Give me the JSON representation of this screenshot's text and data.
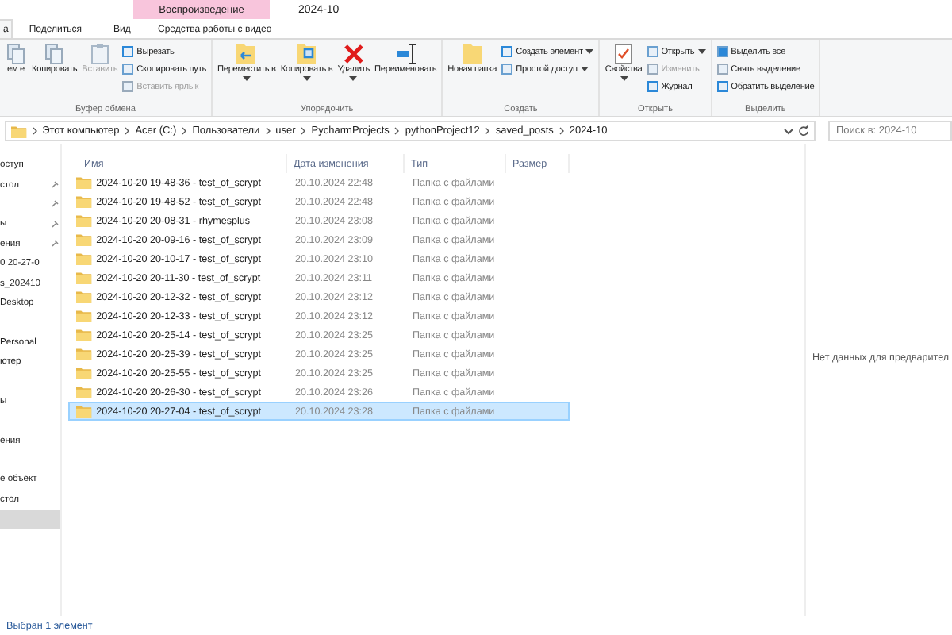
{
  "window": {
    "title": "2024-10",
    "contextual_tab": "Воспроизведение"
  },
  "tabs": [
    {
      "label": "а",
      "selected": true
    },
    {
      "label": "Поделиться",
      "selected": false
    },
    {
      "label": "Вид",
      "selected": false
    },
    {
      "label": "Средства работы с видео",
      "selected": false
    }
  ],
  "ribbon": [
    {
      "name": "Буфер обмена",
      "items": [
        {
          "kind": "large",
          "label": "ем е",
          "disabled": false,
          "dropdown": false
        },
        {
          "kind": "large",
          "label": "Копировать",
          "disabled": false,
          "dropdown": false
        },
        {
          "kind": "large",
          "label": "Вставить",
          "disabled": true,
          "dropdown": false
        },
        {
          "kind": "small",
          "label": "Вырезать",
          "disabled": false,
          "dropdown": false
        },
        {
          "kind": "small",
          "label": "Скопировать путь",
          "disabled": false,
          "dropdown": false
        },
        {
          "kind": "small",
          "label": "Вставить ярлык",
          "disabled": true,
          "dropdown": false
        }
      ]
    },
    {
      "name": "Упорядочить",
      "items": [
        {
          "kind": "large",
          "label": "Переместить в",
          "disabled": false,
          "dropdown": true
        },
        {
          "kind": "large",
          "label": "Копировать в",
          "disabled": false,
          "dropdown": true
        },
        {
          "kind": "large",
          "label": "Удалить",
          "disabled": false,
          "dropdown": true
        },
        {
          "kind": "large",
          "label": "Переименовать",
          "disabled": false,
          "dropdown": false
        }
      ]
    },
    {
      "name": "Создать",
      "items": [
        {
          "kind": "large",
          "label": "Новая папка",
          "disabled": false,
          "dropdown": false
        },
        {
          "kind": "small",
          "label": "Создать элемент",
          "disabled": false,
          "dropdown": true
        },
        {
          "kind": "small",
          "label": "Простой доступ",
          "disabled": false,
          "dropdown": true
        }
      ]
    },
    {
      "name": "Открыть",
      "items": [
        {
          "kind": "large",
          "label": "Свойства",
          "disabled": false,
          "dropdown": true
        },
        {
          "kind": "small",
          "label": "Открыть",
          "disabled": false,
          "dropdown": true
        },
        {
          "kind": "small",
          "label": "Изменить",
          "disabled": true,
          "dropdown": false
        },
        {
          "kind": "small",
          "label": "Журнал",
          "disabled": false,
          "dropdown": false
        }
      ]
    },
    {
      "name": "Выделить",
      "items": [
        {
          "kind": "small",
          "label": "Выделить все",
          "disabled": false,
          "dropdown": false
        },
        {
          "kind": "small",
          "label": "Снять выделение",
          "disabled": false,
          "dropdown": false
        },
        {
          "kind": "small",
          "label": "Обратить выделение",
          "disabled": false,
          "dropdown": false
        }
      ]
    }
  ],
  "address": {
    "crumbs": [
      "Этот компьютер",
      "Acer (C:)",
      "Пользователи",
      "user",
      "PycharmProjects",
      "pythonProject12",
      "saved_posts",
      "2024-10"
    ]
  },
  "search": {
    "placeholder": "Поиск в: 2024-10"
  },
  "sidebar": {
    "items": [
      {
        "label": "оступ",
        "pinned": false,
        "selected": false
      },
      {
        "label": "стол",
        "pinned": true,
        "selected": false
      },
      {
        "pinned": true,
        "selected": false
      },
      {
        "label": "ы",
        "pinned": true,
        "selected": false
      },
      {
        "label": "ения",
        "pinned": true,
        "selected": false
      },
      {
        "label": "0 20-27-0",
        "pinned": false,
        "selected": false
      },
      {
        "label": "s_202410",
        "pinned": false,
        "selected": false
      },
      {
        "label": "Desktop",
        "pinned": false,
        "selected": false
      },
      {
        "pinned": false,
        "selected": false
      },
      {
        "label": "Personal",
        "pinned": false,
        "selected": false
      },
      {
        "label": "ютер",
        "pinned": false,
        "selected": false
      },
      {
        "pinned": false,
        "selected": false
      },
      {
        "label": "ы",
        "pinned": false,
        "selected": false
      },
      {
        "pinned": false,
        "selected": false
      },
      {
        "label": "ения",
        "pinned": false,
        "selected": false
      },
      {
        "pinned": false,
        "selected": false
      },
      {
        "label": "е объект",
        "pinned": false,
        "selected": false
      },
      {
        "label": "стол",
        "pinned": false,
        "selected": false
      },
      {
        "selected": true,
        "pinned": false
      }
    ]
  },
  "table": {
    "columns": [
      "Имя",
      "Дата изменения",
      "Тип",
      "Размер"
    ],
    "rows": [
      {
        "name": "2024-10-20 19-48-36 - test_of_scrypt",
        "date": "20.10.2024 22:48",
        "type": "Папка с файлами",
        "selected": false
      },
      {
        "name": "2024-10-20 19-48-52 - test_of_scrypt",
        "date": "20.10.2024 22:48",
        "type": "Папка с файлами",
        "selected": false
      },
      {
        "name": "2024-10-20 20-08-31 - rhymesplus",
        "date": "20.10.2024 23:08",
        "type": "Папка с файлами",
        "selected": false
      },
      {
        "name": "2024-10-20 20-09-16 - test_of_scrypt",
        "date": "20.10.2024 23:09",
        "type": "Папка с файлами",
        "selected": false
      },
      {
        "name": "2024-10-20 20-10-17 - test_of_scrypt",
        "date": "20.10.2024 23:10",
        "type": "Папка с файлами",
        "selected": false
      },
      {
        "name": "2024-10-20 20-11-30 - test_of_scrypt",
        "date": "20.10.2024 23:11",
        "type": "Папка с файлами",
        "selected": false
      },
      {
        "name": "2024-10-20 20-12-32 - test_of_scrypt",
        "date": "20.10.2024 23:12",
        "type": "Папка с файлами",
        "selected": false
      },
      {
        "name": "2024-10-20 20-12-33 - test_of_scrypt",
        "date": "20.10.2024 23:12",
        "type": "Папка с файлами",
        "selected": false
      },
      {
        "name": "2024-10-20 20-25-14 - test_of_scrypt",
        "date": "20.10.2024 23:25",
        "type": "Папка с файлами",
        "selected": false
      },
      {
        "name": "2024-10-20 20-25-39 - test_of_scrypt",
        "date": "20.10.2024 23:25",
        "type": "Папка с файлами",
        "selected": false
      },
      {
        "name": "2024-10-20 20-25-55 - test_of_scrypt",
        "date": "20.10.2024 23:25",
        "type": "Папка с файлами",
        "selected": false
      },
      {
        "name": "2024-10-20 20-26-30 - test_of_scrypt",
        "date": "20.10.2024 23:26",
        "type": "Папка с файлами",
        "selected": false
      },
      {
        "name": "2024-10-20 20-27-04 - test_of_scrypt",
        "date": "20.10.2024 23:28",
        "type": "Папка с файлами",
        "selected": true
      }
    ]
  },
  "preview": {
    "message": "Нет данных для предварител"
  },
  "status_bar": {
    "text": "Выбран 1 элемент"
  }
}
